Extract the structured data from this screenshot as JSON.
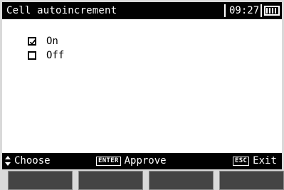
{
  "header": {
    "title": "Cell autoincrement",
    "time": "09:27",
    "battery_level": 0.9
  },
  "options": [
    {
      "label": "On",
      "checked": true,
      "icon": "checked-box-icon"
    },
    {
      "label": "Off",
      "checked": false,
      "icon": "empty-box-icon"
    }
  ],
  "footer": {
    "choose_label": "Choose",
    "choose_icon": "up-down-arrows-icon",
    "enter_key": "ENTER",
    "approve_label": "Approve",
    "esc_key": "ESC",
    "exit_label": "Exit"
  },
  "softkeys": [
    "",
    "",
    "",
    ""
  ],
  "colors": {
    "screen_background": "#ffffff",
    "bars": "#000000",
    "softkey": "#444444",
    "bezel": "#d9d9d9"
  }
}
